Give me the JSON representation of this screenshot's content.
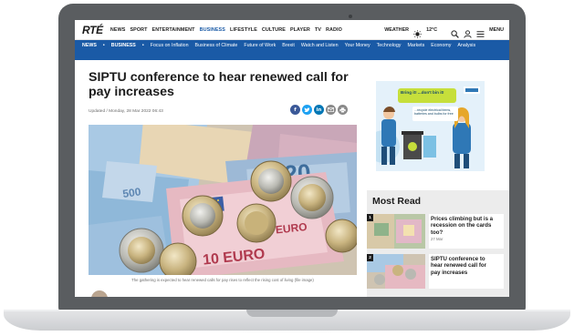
{
  "nav": {
    "logo": "RTÉ",
    "links": [
      "NEWS",
      "SPORT",
      "ENTERTAINMENT",
      "BUSINESS",
      "LIFESTYLE",
      "CULTURE",
      "PLAYER",
      "TV",
      "RADIO"
    ],
    "weather_label": "WEATHER",
    "temperature": "12°C",
    "menu_label": "MENU"
  },
  "subnav": {
    "items": [
      "NEWS",
      "•",
      "BUSINESS",
      "•",
      "Focus on Inflation",
      "Business of Climate",
      "Future of Work",
      "Brexit",
      "Watch and Listen",
      "Your Money",
      "Technology",
      "Markets",
      "Economy",
      "Analysis"
    ]
  },
  "article": {
    "headline": "SIPTU conference to hear renewed call for pay increases",
    "dateline": "Updated / Monday, 28 Mar 2022 06:43",
    "caption": "The gathering is expected to hear renewed calls for pay rises to reflect the rising cost of living (file image)",
    "hero_banknotes": [
      "10 EURO",
      "20",
      "500",
      "EURO"
    ]
  },
  "ad": {
    "bubble_text": "Bring it! ...don't bin it!",
    "note_text": "...recycle electrical items, batteries and bulbs for free"
  },
  "most_read": {
    "title": "Most Read",
    "items": [
      {
        "rank": "1",
        "headline": "Prices climbing but is a recession on the cards too?",
        "time": "27 Mar"
      },
      {
        "rank": "2",
        "headline": "SIPTU conference to hear renewed call for pay increases",
        "time": ""
      }
    ]
  },
  "colors": {
    "brand_blue": "#1a5aa6",
    "facebook": "#3b5998",
    "twitter": "#1da1f2",
    "linkedin": "#0077b5",
    "email": "#8a8a8a",
    "print": "#8a8a8a"
  },
  "share_icons": [
    "facebook-icon",
    "twitter-icon",
    "linkedin-icon",
    "email-icon",
    "print-icon"
  ]
}
